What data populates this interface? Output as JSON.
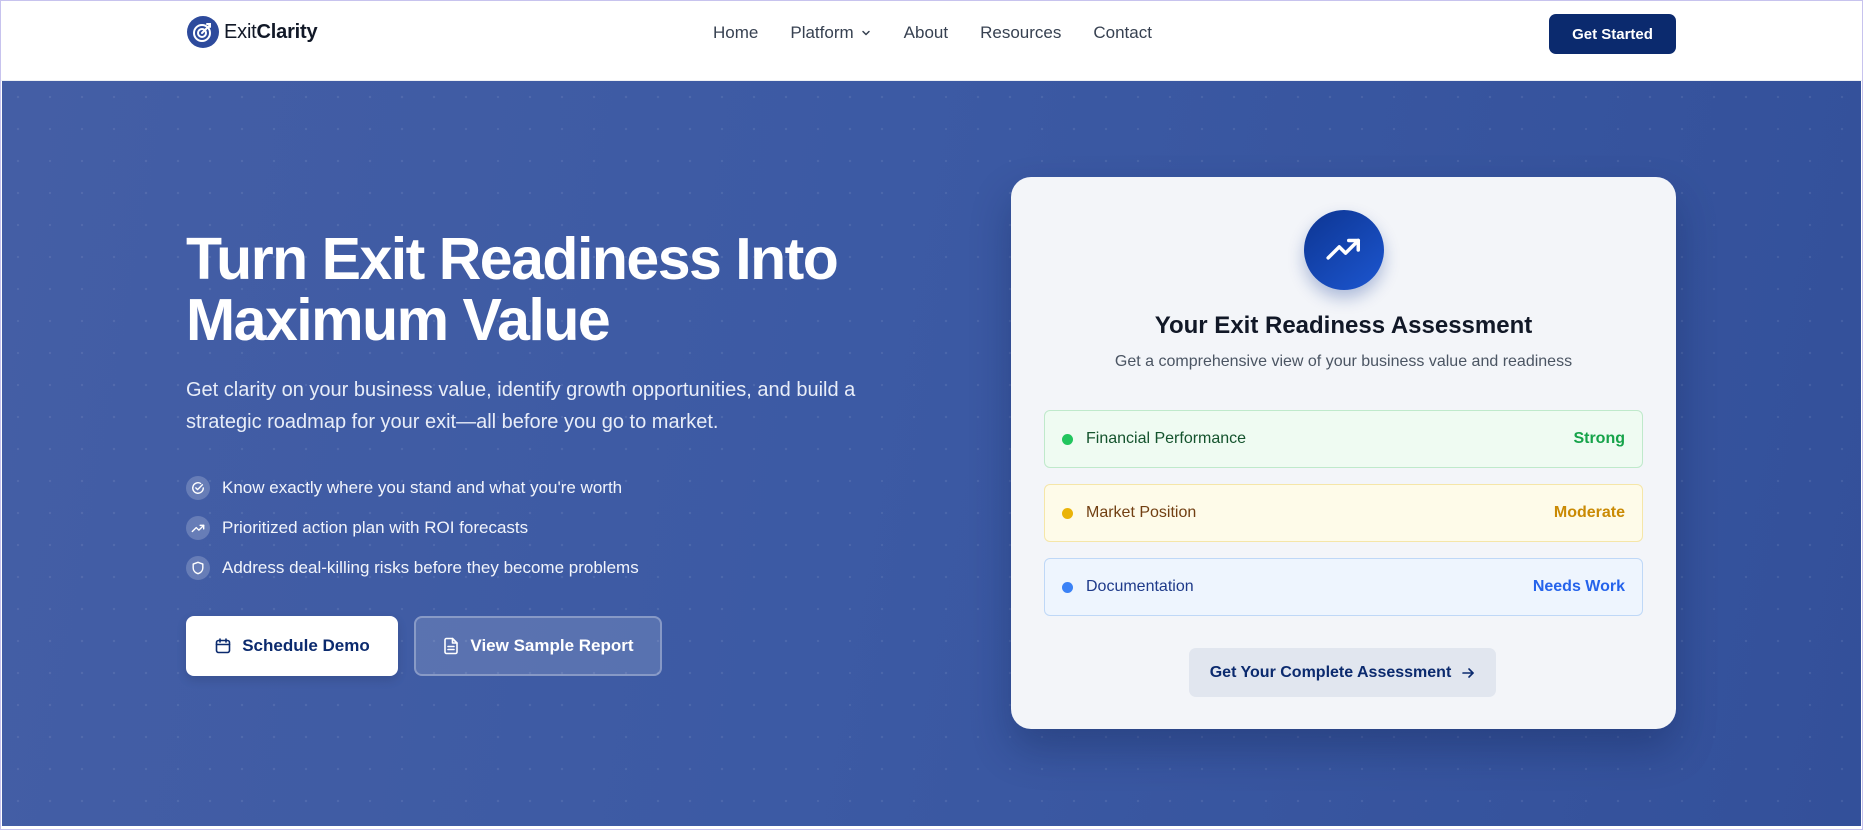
{
  "header": {
    "logo_prefix": "Exit",
    "logo_suffix": "Clarity",
    "nav": [
      {
        "label": "Home",
        "icon": null
      },
      {
        "label": "Platform",
        "icon": "chevron-down-icon"
      },
      {
        "label": "About",
        "icon": null
      },
      {
        "label": "Resources",
        "icon": null
      },
      {
        "label": "Contact",
        "icon": null
      }
    ],
    "cta_label": "Get Started"
  },
  "hero": {
    "title": "Turn Exit Readiness Into Maximum Value",
    "subtitle": "Get clarity on your business value, identify growth opportunities, and build a strategic roadmap for your exit—all before you go to market.",
    "features": [
      {
        "icon": "check-circle-icon",
        "text": "Know exactly where you stand and what you're worth"
      },
      {
        "icon": "trending-up-icon",
        "text": "Prioritized action plan with ROI forecasts"
      },
      {
        "icon": "shield-icon",
        "text": "Address deal-killing risks before they become problems"
      }
    ],
    "primary_button": {
      "label": "Schedule Demo",
      "icon": "calendar-icon"
    },
    "secondary_button": {
      "label": "View Sample Report",
      "icon": "document-icon"
    }
  },
  "card": {
    "icon": "trending-up-icon",
    "title": "Your Exit Readiness Assessment",
    "subtitle": "Get a comprehensive view of your business value and readiness",
    "metrics": [
      {
        "name": "Financial Performance",
        "status": "Strong",
        "color": "#22c55e"
      },
      {
        "name": "Market Position",
        "status": "Moderate",
        "color": "#eab308"
      },
      {
        "name": "Documentation",
        "status": "Needs Work",
        "color": "#3b82f6"
      }
    ],
    "button": {
      "label": "Get Your Complete Assessment",
      "icon": "arrow-right-icon"
    }
  },
  "colors": {
    "brand_navy": "#0b2a6e",
    "hero_blue": "#3d5ba4"
  }
}
